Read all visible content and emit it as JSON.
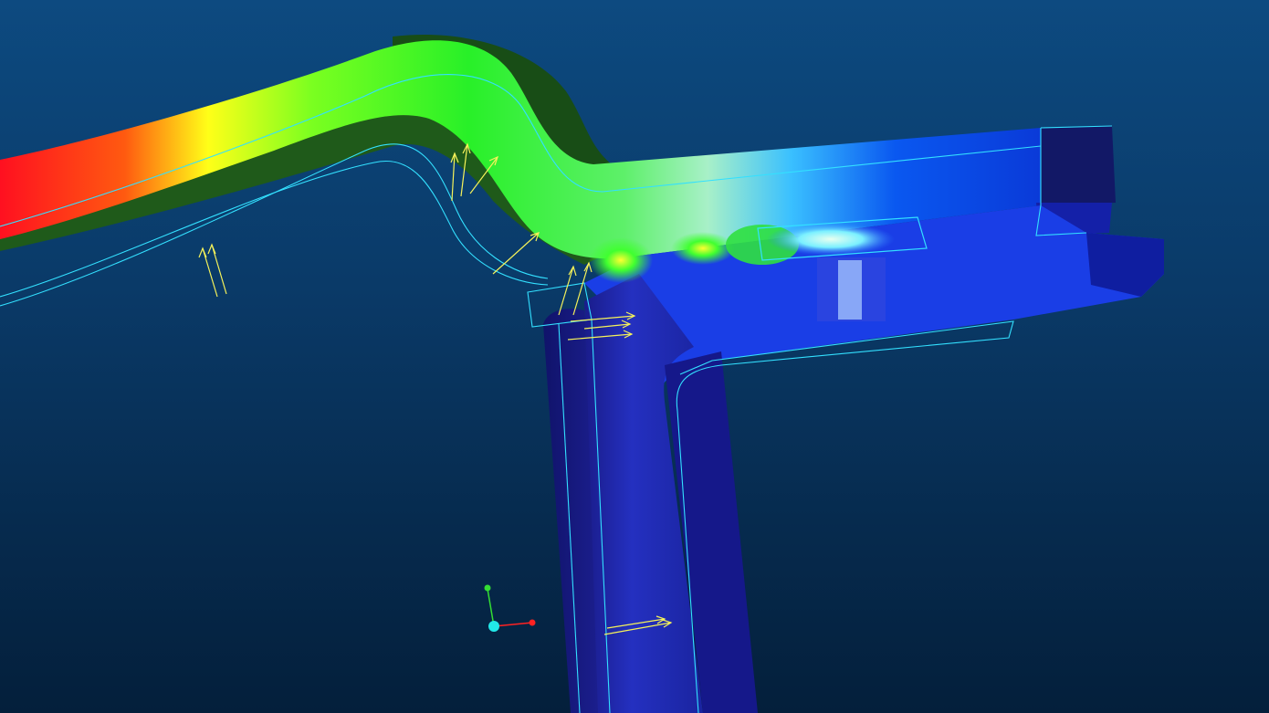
{
  "viewport": {
    "background_top": "#0d4a80",
    "background_bottom": "#041f3b"
  },
  "colors": {
    "edge_outline": "#33e0ff",
    "vector_arrow": "#f5f25a",
    "axis_x": "#ff2222",
    "axis_y": "#33dd33",
    "axis_origin": "#22e8e8"
  },
  "result_contour": {
    "colormap": [
      "#ff1020",
      "#ff7a10",
      "#ffff18",
      "#38ff38",
      "#8ef08c",
      "#38c8ff",
      "#0a3ae8",
      "#1a1aa0"
    ],
    "high_end_color": "#ff1020",
    "low_end_color": "#1a1aa0"
  },
  "icons": {
    "triad": "axis-triad-icon",
    "arrows": "force-vector-arrow"
  }
}
